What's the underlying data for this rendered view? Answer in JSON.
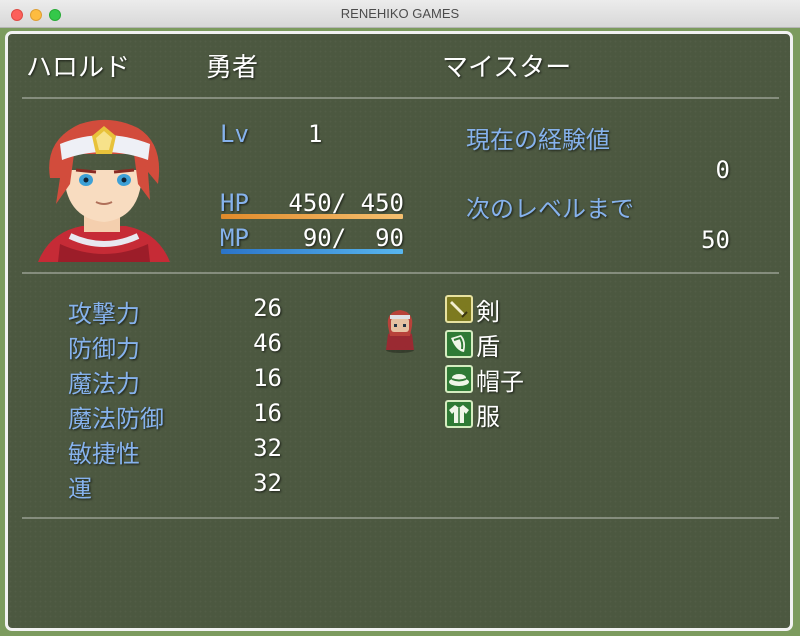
{
  "window": {
    "title": "RENEHIKO GAMES"
  },
  "actor": {
    "name": "ハロルド",
    "class": "勇者",
    "nickname": "マイスター"
  },
  "level": {
    "label": "Lv",
    "value": "1"
  },
  "hp": {
    "label": "HP",
    "value": "450/ 450",
    "current": 450,
    "max": 450,
    "color": "#f0a040"
  },
  "mp": {
    "label": "MP",
    "value": " 90/  90",
    "current": 90,
    "max": 90,
    "color": "#40a0e0"
  },
  "exp": {
    "current_label": "現在の経験値",
    "current_value": "0",
    "next_label": "次のレベルまで",
    "next_value": "50"
  },
  "params": [
    {
      "label": "攻撃力",
      "value": "26"
    },
    {
      "label": "防御力",
      "value": "46"
    },
    {
      "label": "魔法力",
      "value": "16"
    },
    {
      "label": "魔法防御",
      "value": "16"
    },
    {
      "label": "敏捷性",
      "value": "32"
    },
    {
      "label": "運",
      "value": "32"
    }
  ],
  "equips": [
    {
      "icon": "sword-icon",
      "name": "剣"
    },
    {
      "icon": "shield-icon",
      "name": "盾"
    },
    {
      "icon": "hat-icon",
      "name": "帽子"
    },
    {
      "icon": "clothes-icon",
      "name": "服"
    }
  ],
  "colors": {
    "system": "#86b2ec",
    "panel": "#4c5840",
    "border": "#f2f2f2"
  }
}
